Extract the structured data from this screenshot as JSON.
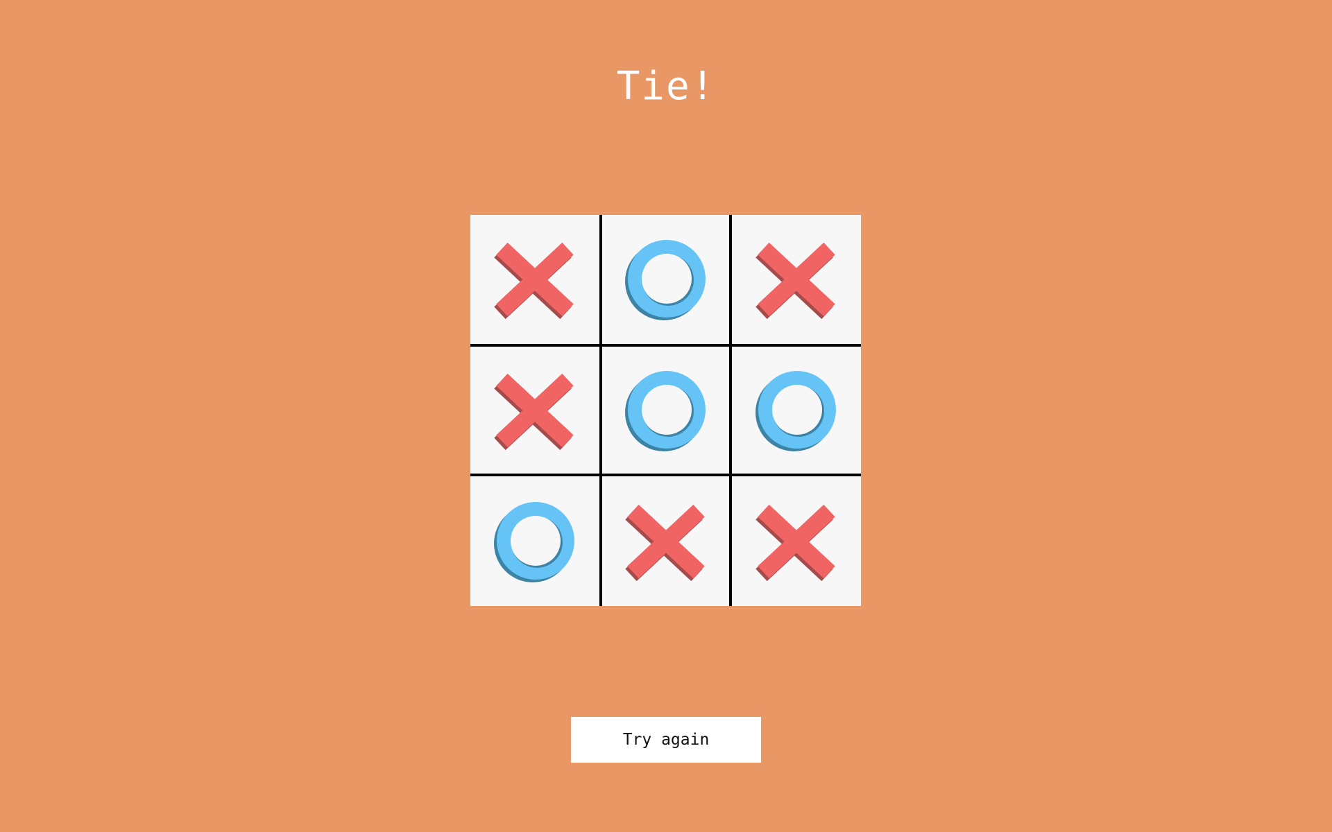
{
  "status": {
    "title": "Tie!"
  },
  "board": {
    "cells": [
      "X",
      "O",
      "X",
      "X",
      "O",
      "O",
      "O",
      "X",
      "X"
    ]
  },
  "actions": {
    "try_again_label": "Try again"
  },
  "colors": {
    "background": "#e99765",
    "cell": "#f7f7f7",
    "grid": "#000000",
    "x_mark": "#f06464",
    "x_shadow": "#a64b4b",
    "o_mark": "#65c4f5",
    "o_shadow": "#3d83a5",
    "button_bg": "#ffffff",
    "button_text": "#111111"
  }
}
